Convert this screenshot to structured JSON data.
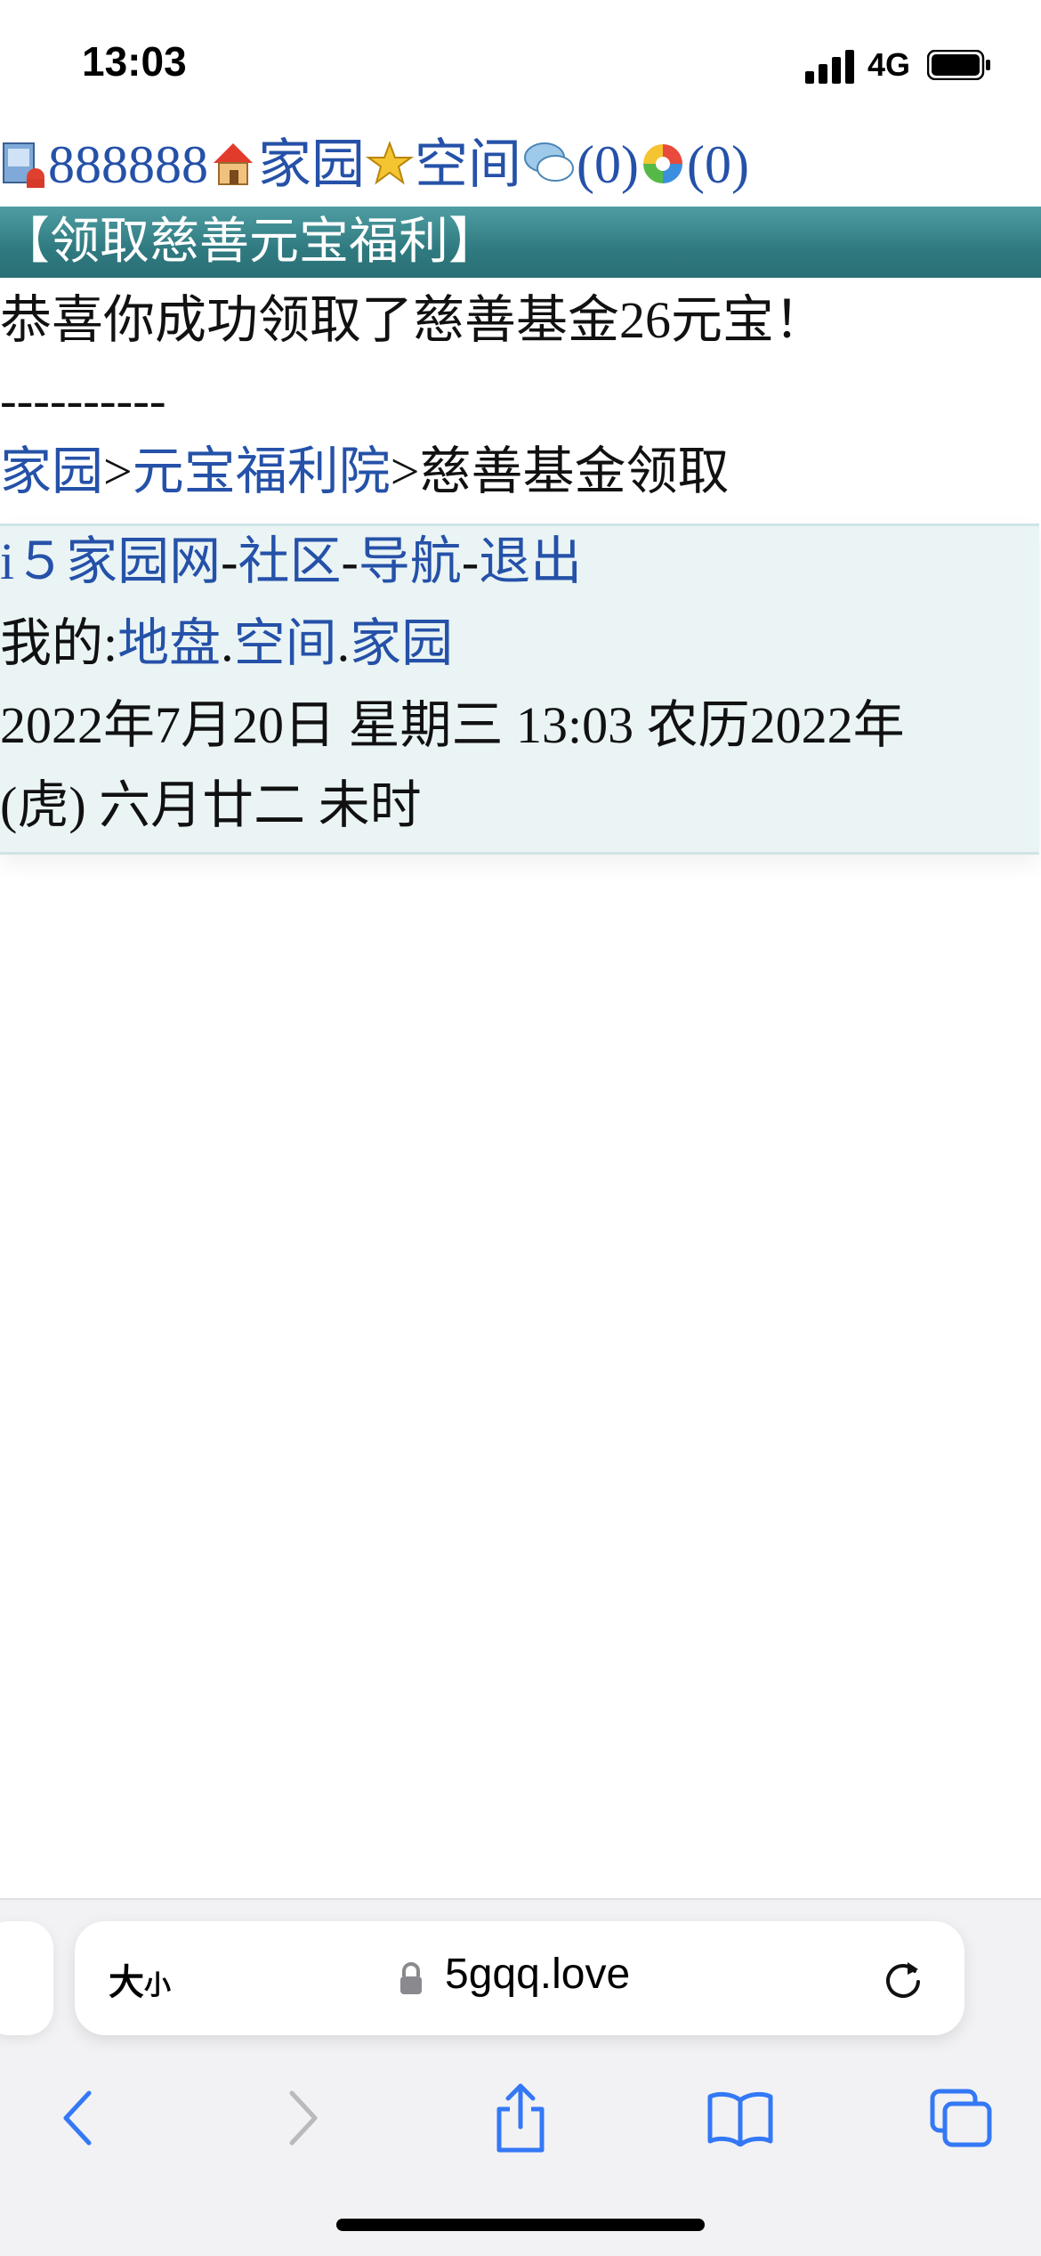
{
  "status": {
    "time": "13:03",
    "network": "4G"
  },
  "header": {
    "user_id": "888888",
    "home_link": "家园",
    "space_link": "空间",
    "messages_count": "(0)",
    "notices_count": "(0)"
  },
  "banner": {
    "title": "【领取慈善元宝福利】"
  },
  "message": {
    "text": "恭喜你成功领取了慈善基金26元宝！"
  },
  "divider": {
    "text": "----------"
  },
  "breadcrumb": {
    "home": "家园",
    "sep1": ">",
    "welfare": "元宝福利院",
    "sep2": ">",
    "current": "慈善基金领取"
  },
  "footer": {
    "site": "i５家园网",
    "sep1": "-",
    "community": "社区",
    "sep2": "-",
    "nav": "导航",
    "sep3": "-",
    "logout": "退出",
    "mine_label": "我的:",
    "turf": "地盘",
    "dot1": ".",
    "space": "空间",
    "dot2": ".",
    "home": "家园",
    "date_line1": "2022年7月20日 星期三 13:03 农历2022年",
    "date_line2": "(虎) 六月廿二 未时"
  },
  "browser": {
    "text_size_big": "大",
    "text_size_small": "小",
    "domain": "5gqq.love"
  },
  "colors": {
    "link": "#2551a8",
    "banner": "#2f7a80",
    "footer_bg": "#eaf4f5",
    "safari_blue": "#3478f6"
  }
}
